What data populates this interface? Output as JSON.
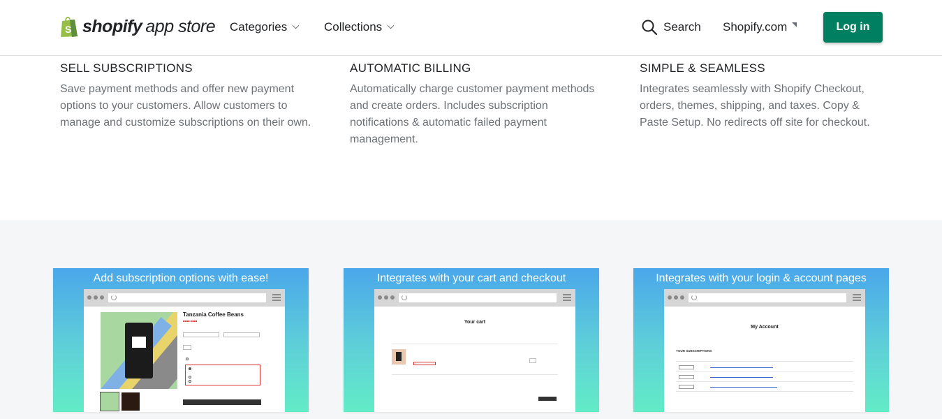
{
  "header": {
    "logo_brand": "shopify",
    "logo_sub": "app store",
    "nav": [
      {
        "label": "Categories"
      },
      {
        "label": "Collections"
      }
    ],
    "search_label": "Search",
    "shopify_link": "Shopify.com",
    "login_label": "Log in",
    "brand_color": "#008060",
    "logo_color": "#95bf47"
  },
  "features": [
    {
      "title": "SELL SUBSCRIPTIONS",
      "text": "Save payment methods and offer new payment options to your customers. Allow customers to manage and customize subscriptions on their own."
    },
    {
      "title": "AUTOMATIC BILLING",
      "text": "Automatically charge customer payment methods and create orders. Includes subscription notifications & automatic failed payment management."
    },
    {
      "title": "SIMPLE & SEAMLESS",
      "text": "Integrates seamlessly with Shopify Checkout, orders, themes, shipping, and taxes. Copy & Paste Setup. No redirects off site for checkout."
    }
  ],
  "screenshots": [
    {
      "title": "Add subscription options with ease!",
      "product_title": "Tanzania Coffee Beans"
    },
    {
      "title": "Integrates with your cart and checkout",
      "cart_title": "Your cart"
    },
    {
      "title": "Integrates with your login & account pages",
      "account_title": "My Account",
      "subs_heading": "YOUR SUBSCRIPTIONS"
    }
  ],
  "icons": {
    "logo": "shopping-bag-icon",
    "search": "magnifier-icon",
    "external": "external-arrow-icon",
    "chevron": "chevron-down-icon"
  }
}
